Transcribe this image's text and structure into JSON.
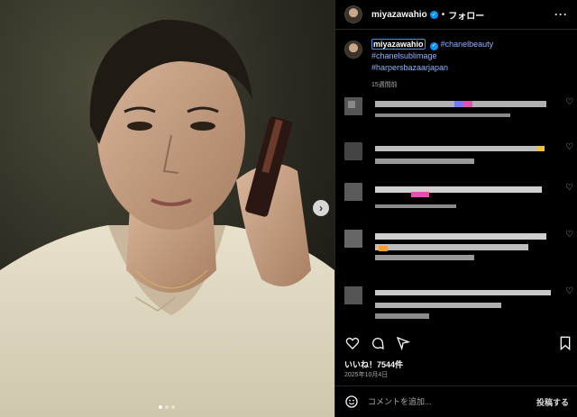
{
  "post": {
    "author": "miyazawahio",
    "follow_label": "フォロー",
    "separator": "•",
    "more_icon": "more-horizontal-icon",
    "caption": {
      "hashtags": [
        "#chanelbeauty",
        "#chanelsublimage",
        "#harpersbazaarjapan"
      ],
      "time_ago": "15週間前"
    },
    "likes": "いいね！7544件",
    "date": "2025年10月4日",
    "comment_placeholder": "コメントを追加...",
    "post_label": "投稿する",
    "carousel": {
      "current": 1,
      "count": 3
    }
  },
  "icons": [
    "heart-icon",
    "comment-icon",
    "share-icon",
    "bookmark-icon",
    "emoji-icon",
    "chevron-right-icon"
  ],
  "colors": {
    "background": "#000000",
    "link": "#8fb3ff",
    "verified": "#0095f6"
  }
}
